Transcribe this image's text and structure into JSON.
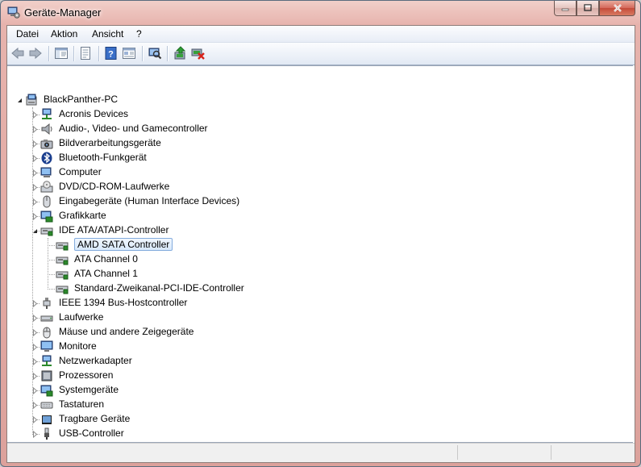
{
  "window": {
    "title": "Geräte-Manager",
    "icon": "device-manager-icon",
    "accent_color": "#dca19b"
  },
  "menu": {
    "items": [
      "Datei",
      "Aktion",
      "Ansicht",
      "?"
    ]
  },
  "toolbar": {
    "buttons": [
      "back-arrow-icon",
      "forward-arrow-icon",
      "show-hide-tree-icon",
      "properties-icon",
      "help-icon",
      "view-icon",
      "scan-hardware-icon",
      "update-driver-icon",
      "uninstall-icon"
    ]
  },
  "tree": {
    "root": "BlackPanther-PC",
    "categories": [
      {
        "label": "Acronis Devices",
        "icon": "network-device-icon"
      },
      {
        "label": "Audio-, Video- und Gamecontroller",
        "icon": "speaker-icon"
      },
      {
        "label": "Bildverarbeitungsgeräte",
        "icon": "camera-icon"
      },
      {
        "label": "Bluetooth-Funkgerät",
        "icon": "bluetooth-icon"
      },
      {
        "label": "Computer",
        "icon": "computer-icon"
      },
      {
        "label": "DVD/CD-ROM-Laufwerke",
        "icon": "disc-drive-icon"
      },
      {
        "label": "Eingabegeräte (Human Interface Devices)",
        "icon": "hid-icon"
      },
      {
        "label": "Grafikkarte",
        "icon": "display-adapter-icon"
      },
      {
        "label": "IDE ATA/ATAPI-Controller",
        "icon": "ide-controller-icon",
        "expanded": true,
        "children": [
          "AMD SATA Controller",
          "ATA Channel 0",
          "ATA Channel 1",
          "Standard-Zweikanal-PCI-IDE-Controller"
        ]
      },
      {
        "label": "IEEE 1394 Bus-Hostcontroller",
        "icon": "firewire-icon"
      },
      {
        "label": "Laufwerke",
        "icon": "hard-drive-icon"
      },
      {
        "label": "Mäuse und andere Zeigegeräte",
        "icon": "mouse-icon"
      },
      {
        "label": "Monitore",
        "icon": "monitor-icon"
      },
      {
        "label": "Netzwerkadapter",
        "icon": "network-adapter-icon"
      },
      {
        "label": "Prozessoren",
        "icon": "processor-icon"
      },
      {
        "label": "Systemgeräte",
        "icon": "system-devices-icon"
      },
      {
        "label": "Tastaturen",
        "icon": "keyboard-icon"
      },
      {
        "label": "Tragbare Geräte",
        "icon": "portable-device-icon"
      },
      {
        "label": "USB-Controller",
        "icon": "usb-icon"
      }
    ],
    "selected": "AMD SATA Controller"
  }
}
